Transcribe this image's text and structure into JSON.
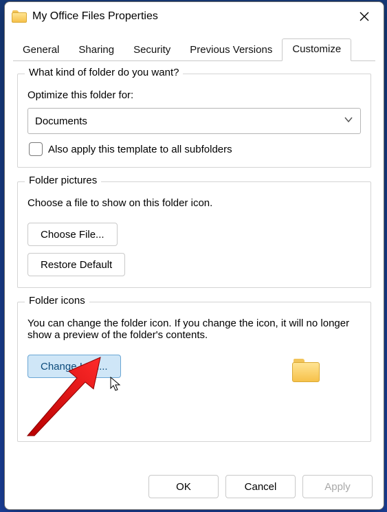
{
  "window": {
    "title": "My Office Files Properties"
  },
  "tabs": {
    "general": "General",
    "sharing": "Sharing",
    "security": "Security",
    "previous": "Previous Versions",
    "customize": "Customize"
  },
  "group_kind": {
    "legend": "What kind of folder do you want?",
    "optimize_label": "Optimize this folder for:",
    "selected": "Documents",
    "subfolders": "Also apply this template to all subfolders"
  },
  "group_pictures": {
    "legend": "Folder pictures",
    "desc": "Choose a file to show on this folder icon.",
    "choose": "Choose File...",
    "restore": "Restore Default"
  },
  "group_icons": {
    "legend": "Folder icons",
    "desc": "You can change the folder icon. If you change the icon, it will no longer show a preview of the folder's contents.",
    "change": "Change Icon..."
  },
  "buttons": {
    "ok": "OK",
    "cancel": "Cancel",
    "apply": "Apply"
  }
}
